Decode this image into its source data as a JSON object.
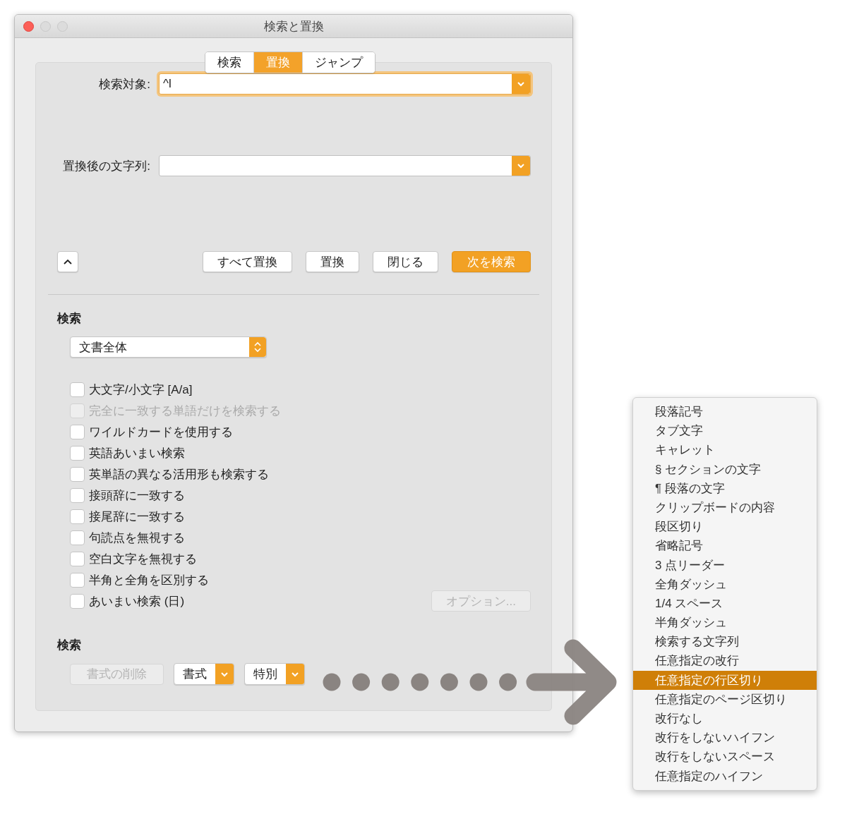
{
  "window": {
    "title": "検索と置換"
  },
  "tabs": [
    {
      "label": "検索",
      "selected": false
    },
    {
      "label": "置換",
      "selected": true
    },
    {
      "label": "ジャンプ",
      "selected": false
    }
  ],
  "find_field": {
    "label": "検索対象:",
    "value": "^l",
    "focused": true
  },
  "replace_field": {
    "label": "置換後の文字列:",
    "focused": false
  },
  "action_buttons": [
    {
      "label": "すべて置換",
      "default": false
    },
    {
      "label": "置換",
      "default": false
    },
    {
      "label": "閉じる",
      "default": false
    },
    {
      "label": "次を検索",
      "default": true
    }
  ],
  "search_heading": "検索",
  "scope_popup": {
    "value": "文書全体"
  },
  "options": [
    {
      "label": "大文字/小文字 [A/a]",
      "checked": false,
      "disabled": false
    },
    {
      "label": "完全に一致する単語だけを検索する",
      "checked": false,
      "disabled": true
    },
    {
      "label": "ワイルドカードを使用する",
      "checked": false,
      "disabled": false
    },
    {
      "label": "英語あいまい検索",
      "checked": false,
      "disabled": false
    },
    {
      "label": "英単語の異なる活用形も検索する",
      "checked": false,
      "disabled": false
    },
    {
      "label": "接頭辞に一致する",
      "checked": false,
      "disabled": false
    },
    {
      "label": "接尾辞に一致する",
      "checked": false,
      "disabled": false
    },
    {
      "label": "句読点を無視する",
      "checked": false,
      "disabled": false
    },
    {
      "label": "空白文字を無視する",
      "checked": false,
      "disabled": false
    },
    {
      "label": "半角と全角を区別する",
      "checked": false,
      "disabled": false
    },
    {
      "label": "あいまい検索 (日)",
      "checked": false,
      "disabled": false
    }
  ],
  "options_button": {
    "label": "オプション...",
    "disabled": true
  },
  "format_heading": "検索",
  "format_buttons": [
    {
      "kind": "plain",
      "label": "書式の削除",
      "disabled": true
    },
    {
      "kind": "menu",
      "label": "書式",
      "disabled": false
    },
    {
      "kind": "menu",
      "label": "特別",
      "disabled": false
    }
  ],
  "special_menu": {
    "items": [
      {
        "label": "段落記号",
        "selected": false
      },
      {
        "label": "タブ文字",
        "selected": false
      },
      {
        "label": "キャレット",
        "selected": false
      },
      {
        "label": "§ セクションの文字",
        "selected": false
      },
      {
        "label": "¶ 段落の文字",
        "selected": false
      },
      {
        "label": "クリップボードの内容",
        "selected": false
      },
      {
        "label": "段区切り",
        "selected": false
      },
      {
        "label": "省略記号",
        "selected": false
      },
      {
        "label": "3 点リーダー",
        "selected": false
      },
      {
        "label": "全角ダッシュ",
        "selected": false
      },
      {
        "label": "1/4 スペース",
        "selected": false
      },
      {
        "label": "半角ダッシュ",
        "selected": false
      },
      {
        "label": "検索する文字列",
        "selected": false
      },
      {
        "label": "任意指定の改行",
        "selected": false
      },
      {
        "label": "任意指定の行区切り",
        "selected": true
      },
      {
        "label": "任意指定のページ区切り",
        "selected": false
      },
      {
        "label": "改行なし",
        "selected": false
      },
      {
        "label": "改行をしないハイフン",
        "selected": false
      },
      {
        "label": "改行をしないスペース",
        "selected": false
      },
      {
        "label": "任意指定のハイフン",
        "selected": false
      }
    ]
  }
}
